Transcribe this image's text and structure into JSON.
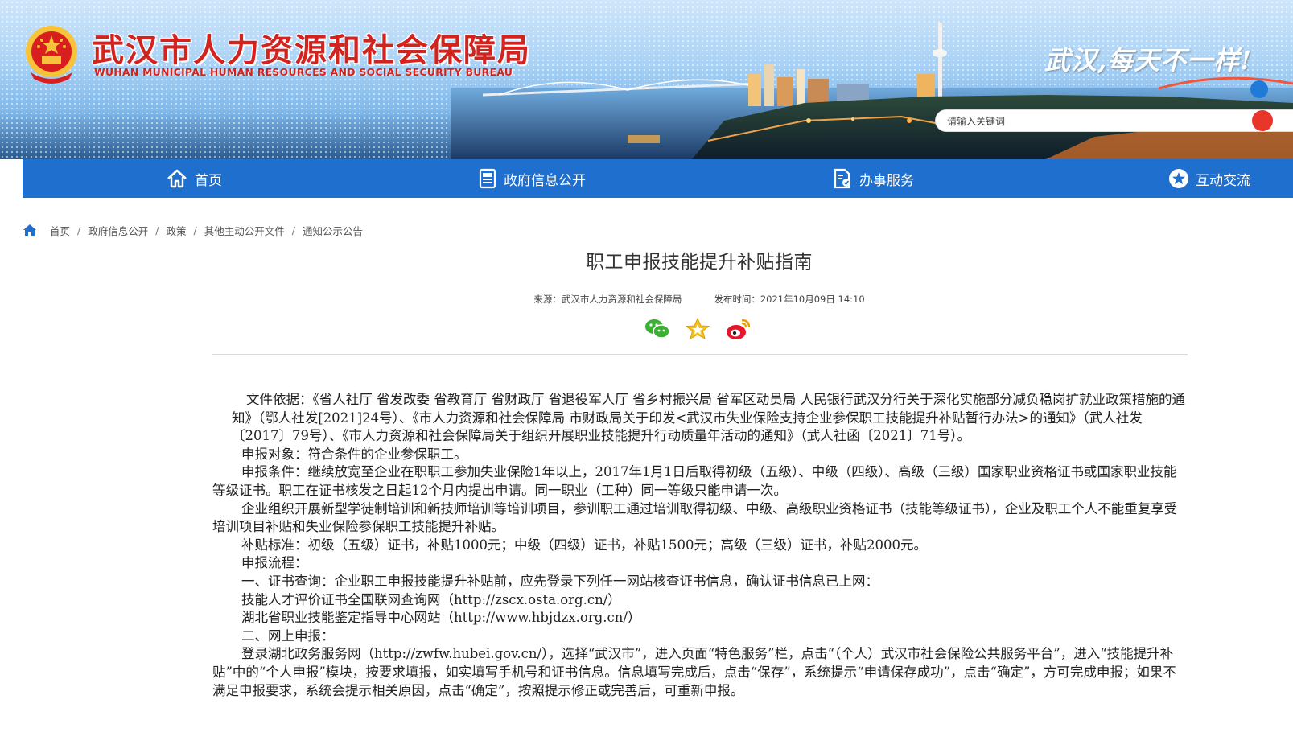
{
  "header": {
    "title": "武汉市人力资源和社会保障局",
    "subtitle": "WUHAN MUNICIPAL HUMAN RESOURCES AND SOCIAL SECURITY BUREAU",
    "slogan": "武汉,每天不一样!",
    "search_placeholder": "请输入关键词"
  },
  "nav": {
    "items": [
      {
        "label": "首页",
        "icon": "home-icon"
      },
      {
        "label": "政府信息公开",
        "icon": "document-icon"
      },
      {
        "label": "办事服务",
        "icon": "service-form-icon"
      },
      {
        "label": "互动交流",
        "icon": "star-circle-icon"
      }
    ]
  },
  "breadcrumb": {
    "items": [
      "首页",
      "政府信息公开",
      "政策",
      "其他主动公开文件",
      "通知公示公告"
    ],
    "separator": "/"
  },
  "article": {
    "title": "职工申报技能提升补贴指南",
    "source_label": "来源：",
    "source": "武汉市人力资源和社会保障局",
    "date_label": "发布时间：",
    "date": "2021年10月09日 14:10",
    "paragraphs": [
      "文件依据：《省人社厅 省发改委 省教育厅 省财政厅 省退役军人厅 省乡村振兴局 省军区动员局 人民银行武汉分行关于深化实施部分减负稳岗扩就业政策措施的通知》（鄂人社发[2021]24号）、《市人力资源和社会保障局 市财政局关于印发<武汉市失业保险支持企业参保职工技能提升补贴暂行办法>的通知》（武人社发〔2017〕79号）、《市人力资源和社会保障局关于组织开展职业技能提升行动质量年活动的通知》（武人社函〔2021〕71号）。",
      "申报对象：符合条件的企业参保职工。",
      "申报条件：继续放宽至企业在职职工参加失业保险1年以上，2017年1月1日后取得初级（五级）、中级（四级）、高级（三级）国家职业资格证书或国家职业技能等级证书。职工在证书核发之日起12个月内提出申请。同一职业（工种）同一等级只能申请一次。",
      "企业组织开展新型学徒制培训和新技师培训等培训项目，参训职工通过培训取得初级、中级、高级职业资格证书（技能等级证书），企业及职工个人不能重复享受培训项目补贴和失业保险参保职工技能提升补贴。",
      "补贴标准：初级（五级）证书，补贴1000元；中级（四级）证书，补贴1500元；高级（三级）证书，补贴2000元。",
      "申报流程：",
      "一、证书查询：企业职工申报技能提升补贴前，应先登录下列任一网站核查证书信息，确认证书信息已上网：",
      "技能人才评价证书全国联网查询网（http://zscx.osta.org.cn/）",
      "湖北省职业技能鉴定指导中心网站（http://www.hbjdzx.org.cn/）",
      "二、网上申报：",
      "登录湖北政务服务网（http://zwfw.hubei.gov.cn/），选择“武汉市”，进入页面“特色服务”栏，点击“（个人）武汉市社会保险公共服务平台”，进入“技能提升补贴”中的“个人申报”模块，按要求填报，如实填写手机号和证书信息。信息填写完成后，点击“保存”，系统提示“申请保存成功”，点击“确定”，方可完成申报；如果不满足申报要求，系统会提示相关原因，点击“确定”，按照提示修正或完善后，可重新申报。"
    ]
  },
  "share": {
    "icons": [
      "wechat-icon",
      "favorite-star-icon",
      "weibo-icon"
    ]
  },
  "colors": {
    "nav_blue": "#1e6fce",
    "title_red": "#d3231f",
    "search_red": "#e8362a"
  }
}
